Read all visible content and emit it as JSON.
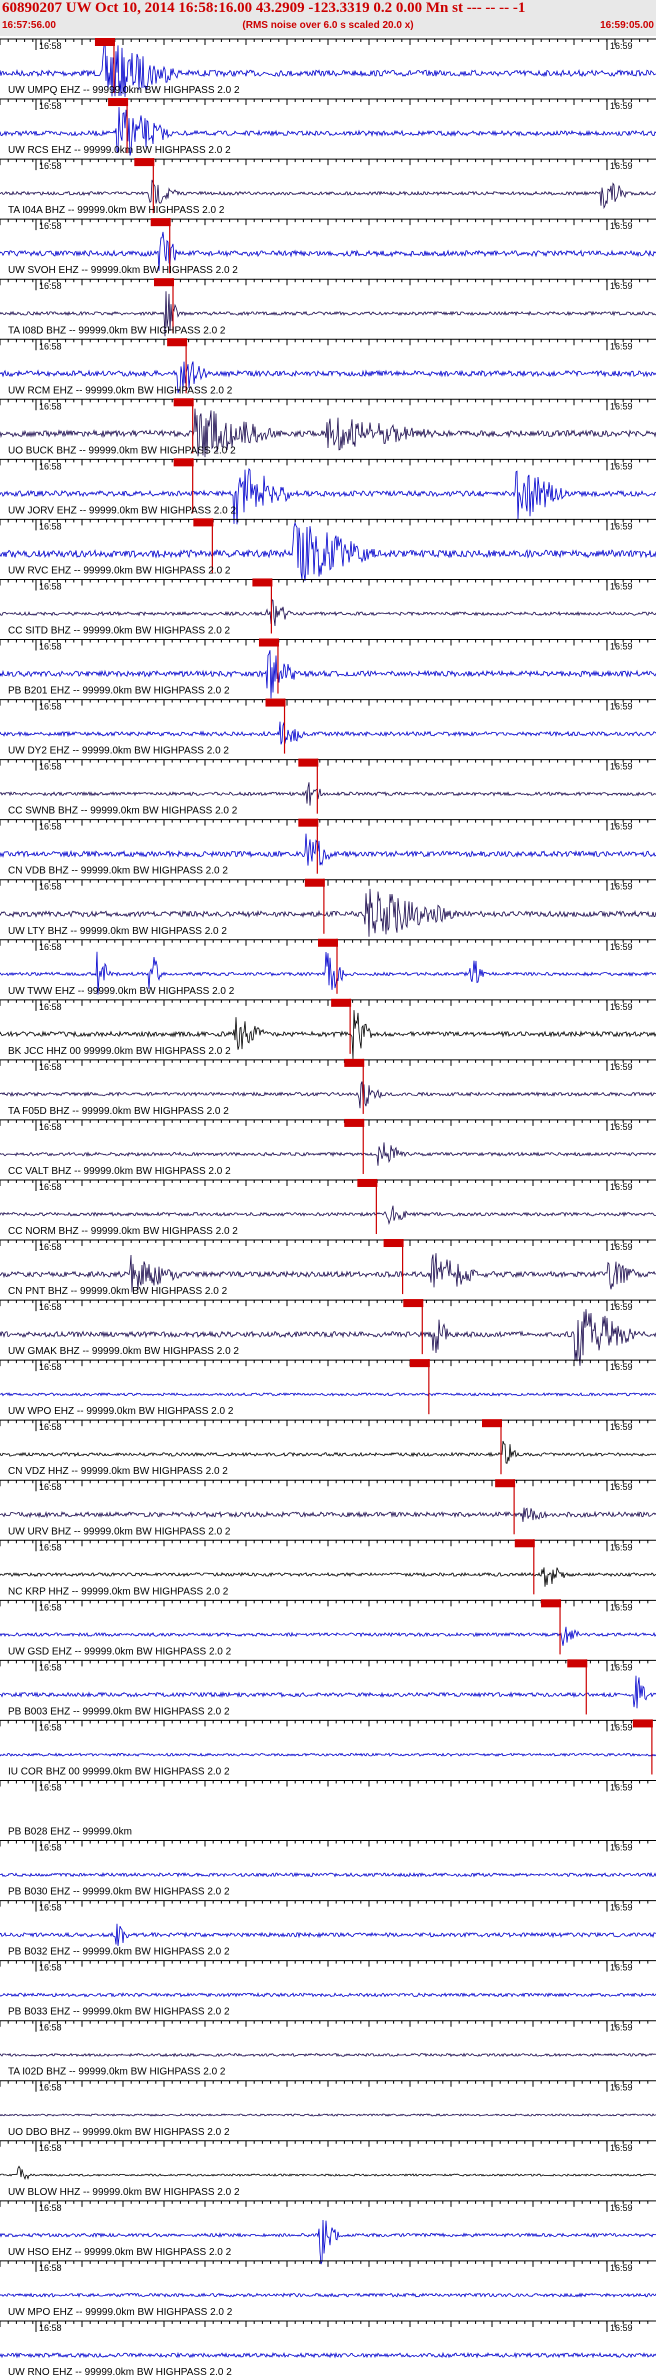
{
  "header": {
    "title": "60890207 UW Oct 10, 2014 16:58:16.00   43.2909 -123.3319  0.2 0.00 Mn st --- -- --  -1",
    "time_start": "16:57:56.00",
    "time_end": "16:59:05.00",
    "rms_note": "(RMS noise over 6.0 s scaled 20.0 x)"
  },
  "minute_labels": {
    "left": "16:58",
    "right": "16:59"
  },
  "colors": {
    "blue": "#0000cc",
    "navy": "#1a0a4d",
    "black": "#000000",
    "pick": "#cc0000"
  },
  "chart_data": {
    "type": "seismogram",
    "title": "60890207 UW Oct 10, 2014 16:58:16.00   43.2909 -123.3319  0.2 0.00 Mn st --- -- --  -1",
    "x_range": [
      "16:57:56.00",
      "16:59:05.00"
    ],
    "traces": [
      {
        "label": "UW UMPQ EHZ -- 99999.0km BW  HIGHPASS  2.0  2",
        "color": "blue",
        "amp": 0.18,
        "pick": 0.16,
        "bursts": [
          [
            0.16,
            0.13,
            1.0
          ]
        ]
      },
      {
        "label": "UW RCS EHZ -- 99999.0km BW  HIGHPASS  2.0  2",
        "color": "blue",
        "amp": 0.14,
        "pick": 0.18,
        "bursts": [
          [
            0.18,
            0.09,
            0.9
          ]
        ]
      },
      {
        "label": "TA I04A BHZ -- 99999.0km BW  HIGHPASS  2.0  2",
        "color": "navy",
        "amp": 0.1,
        "pick": 0.22,
        "bursts": [
          [
            0.23,
            0.05,
            0.45
          ],
          [
            0.92,
            0.05,
            0.5
          ]
        ]
      },
      {
        "label": "UW SVOH EHZ -- 99999.0km BW  HIGHPASS  2.0  2",
        "color": "blue",
        "amp": 0.16,
        "pick": 0.245,
        "bursts": [
          [
            0.245,
            0.03,
            0.8
          ]
        ]
      },
      {
        "label": "TA I08D BHZ -- 99999.0km BW  HIGHPASS  2.0  2",
        "color": "navy",
        "amp": 0.1,
        "pick": 0.25,
        "bursts": [
          [
            0.255,
            0.02,
            0.7
          ]
        ]
      },
      {
        "label": "UW RCM EHZ -- 99999.0km BW  HIGHPASS  2.0  2",
        "color": "blue",
        "amp": 0.16,
        "pick": 0.27,
        "bursts": [
          [
            0.275,
            0.05,
            0.6
          ]
        ]
      },
      {
        "label": "UO BUCK BHZ -- 99999.0km BW  HIGHPASS  2.0  2",
        "color": "navy",
        "amp": 0.18,
        "pick": 0.28,
        "bursts": [
          [
            0.3,
            0.14,
            0.85
          ],
          [
            0.5,
            0.2,
            0.55
          ]
        ]
      },
      {
        "label": "UW JORV EHZ -- 99999.0km BW  HIGHPASS  2.0  2",
        "color": "blue",
        "amp": 0.16,
        "pick": 0.28,
        "bursts": [
          [
            0.36,
            0.1,
            0.95
          ],
          [
            0.79,
            0.08,
            0.95
          ]
        ]
      },
      {
        "label": "UW RVC EHZ -- 99999.0km BW  HIGHPASS  2.0  2",
        "color": "blue",
        "amp": 0.22,
        "pick": 0.31,
        "bursts": [
          [
            0.45,
            0.14,
            1.0
          ]
        ]
      },
      {
        "label": "CC SITD BHZ -- 99999.0km BW  HIGHPASS  2.0  2",
        "color": "navy",
        "amp": 0.1,
        "pick": 0.4,
        "bursts": [
          [
            0.41,
            0.04,
            0.5
          ]
        ]
      },
      {
        "label": "PB B201 EHZ -- 99999.0km BW  HIGHPASS  2.0  2",
        "color": "blue",
        "amp": 0.16,
        "pick": 0.41,
        "bursts": [
          [
            0.41,
            0.05,
            0.8
          ]
        ]
      },
      {
        "label": "UW DY2 EHZ -- 99999.0km BW  HIGHPASS  2.0  2",
        "color": "blue",
        "amp": 0.12,
        "pick": 0.42,
        "bursts": [
          [
            0.43,
            0.04,
            0.5
          ]
        ]
      },
      {
        "label": "CC SWNB BHZ -- 99999.0km BW  HIGHPASS  2.0  2",
        "color": "navy",
        "amp": 0.1,
        "pick": 0.47,
        "bursts": [
          [
            0.47,
            0.03,
            0.4
          ]
        ]
      },
      {
        "label": "CN VDB BHZ -- 99999.0km BW  HIGHPASS  2.0  2",
        "color": "blue",
        "amp": 0.16,
        "pick": 0.47,
        "bursts": [
          [
            0.47,
            0.04,
            0.75
          ]
        ]
      },
      {
        "label": "UW LTY BHZ -- 99999.0km BW  HIGHPASS  2.0  2",
        "color": "navy",
        "amp": 0.16,
        "pick": 0.48,
        "bursts": [
          [
            0.56,
            0.16,
            0.8
          ]
        ]
      },
      {
        "label": "UW TWW EHZ -- 99999.0km BW  HIGHPASS  2.0  2",
        "color": "blue",
        "amp": 0.1,
        "pick": 0.5,
        "bursts": [
          [
            0.15,
            0.02,
            0.7
          ],
          [
            0.23,
            0.02,
            0.7
          ],
          [
            0.5,
            0.03,
            0.7
          ],
          [
            0.72,
            0.02,
            0.6
          ]
        ]
      },
      {
        "label": "BK JCC HHZ 00 99999.0km BW  HIGHPASS  2.0  2",
        "color": "black",
        "amp": 0.14,
        "pick": 0.52,
        "bursts": [
          [
            0.36,
            0.05,
            0.7
          ],
          [
            0.54,
            0.03,
            0.8
          ]
        ]
      },
      {
        "label": "TA F05D BHZ -- 99999.0km BW  HIGHPASS  2.0  2",
        "color": "navy",
        "amp": 0.1,
        "pick": 0.54,
        "bursts": [
          [
            0.55,
            0.04,
            0.5
          ]
        ]
      },
      {
        "label": "CC VALT BHZ -- 99999.0km BW  HIGHPASS  2.0  2",
        "color": "navy",
        "amp": 0.1,
        "pick": 0.54,
        "bursts": [
          [
            0.58,
            0.05,
            0.4
          ]
        ]
      },
      {
        "label": "CC NORM BHZ -- 99999.0km BW  HIGHPASS  2.0  2",
        "color": "navy",
        "amp": 0.1,
        "pick": 0.56,
        "bursts": [
          [
            0.59,
            0.04,
            0.35
          ]
        ]
      },
      {
        "label": "CN PNT BHZ -- 99999.0km BW  HIGHPASS  2.0  2",
        "color": "navy",
        "amp": 0.16,
        "pick": 0.6,
        "bursts": [
          [
            0.2,
            0.09,
            0.6
          ],
          [
            0.66,
            0.08,
            0.7
          ],
          [
            0.93,
            0.05,
            0.5
          ]
        ]
      },
      {
        "label": "UW GMAK BHZ -- 99999.0km BW  HIGHPASS  2.0  2",
        "color": "navy",
        "amp": 0.16,
        "pick": 0.63,
        "bursts": [
          [
            0.66,
            0.03,
            0.7
          ],
          [
            0.88,
            0.1,
            1.0
          ]
        ]
      },
      {
        "label": "UW WPO EHZ -- 99999.0km BW  HIGHPASS  2.0  2",
        "color": "blue",
        "amp": 0.08,
        "pick": 0.64,
        "bursts": []
      },
      {
        "label": "CN VDZ HHZ -- 99999.0km BW  HIGHPASS  2.0  2",
        "color": "black",
        "amp": 0.1,
        "pick": 0.75,
        "bursts": [
          [
            0.77,
            0.02,
            0.5
          ]
        ]
      },
      {
        "label": "UW URV BHZ -- 99999.0km BW  HIGHPASS  2.0  2",
        "color": "navy",
        "amp": 0.14,
        "pick": 0.77,
        "bursts": [
          [
            0.8,
            0.04,
            0.4
          ]
        ]
      },
      {
        "label": "NC KRP HHZ -- 99999.0km BW  HIGHPASS  2.0  2",
        "color": "black",
        "amp": 0.1,
        "pick": 0.8,
        "bursts": [
          [
            0.83,
            0.04,
            0.45
          ]
        ]
      },
      {
        "label": "UW GSD EHZ -- 99999.0km BW  HIGHPASS  2.0  2",
        "color": "blue",
        "amp": 0.1,
        "pick": 0.84,
        "bursts": [
          [
            0.86,
            0.03,
            0.35
          ]
        ]
      },
      {
        "label": "PB B003 EHZ -- 99999.0km BW  HIGHPASS  2.0  2",
        "color": "blue",
        "amp": 0.12,
        "pick": 0.88,
        "bursts": [
          [
            0.97,
            0.02,
            0.8
          ]
        ]
      },
      {
        "label": "IU COR BHZ 00 99999.0km BW  HIGHPASS  2.0  2",
        "color": "blue",
        "amp": 0.08,
        "pick": 0.98,
        "bursts": []
      },
      {
        "label": "PB B028 EHZ -- 99999.0km",
        "color": "blue",
        "amp": 0.0,
        "pick": null,
        "bursts": []
      },
      {
        "label": "PB B030 EHZ -- 99999.0km BW  HIGHPASS  2.0  2",
        "color": "blue",
        "amp": 0.1,
        "pick": null,
        "bursts": []
      },
      {
        "label": "PB B032 EHZ -- 99999.0km BW  HIGHPASS  2.0  2",
        "color": "blue",
        "amp": 0.12,
        "pick": null,
        "bursts": [
          [
            0.18,
            0.02,
            0.4
          ]
        ]
      },
      {
        "label": "PB B033 EHZ -- 99999.0km BW  HIGHPASS  2.0  2",
        "color": "blue",
        "amp": 0.1,
        "pick": null,
        "bursts": []
      },
      {
        "label": "TA I02D BHZ -- 99999.0km BW  HIGHPASS  2.0  2",
        "color": "navy",
        "amp": 0.08,
        "pick": null,
        "bursts": []
      },
      {
        "label": "UO DBO BHZ -- 99999.0km BW  HIGHPASS  2.0  2",
        "color": "navy",
        "amp": 0.06,
        "pick": null,
        "bursts": []
      },
      {
        "label": "UW BLOW HHZ -- 99999.0km BW  HIGHPASS  2.0  2",
        "color": "black",
        "amp": 0.06,
        "pick": null,
        "bursts": [
          [
            0.03,
            0.02,
            0.3
          ]
        ]
      },
      {
        "label": "UW HSO EHZ -- 99999.0km BW  HIGHPASS  2.0  2",
        "color": "blue",
        "amp": 0.1,
        "pick": null,
        "bursts": [
          [
            0.49,
            0.03,
            0.9
          ]
        ]
      },
      {
        "label": "UW MPO EHZ -- 99999.0km BW  HIGHPASS  2.0  2",
        "color": "blue",
        "amp": 0.1,
        "pick": null,
        "bursts": []
      },
      {
        "label": "UW RNO EHZ -- 99999.0km BW  HIGHPASS  2.0  2",
        "color": "blue",
        "amp": 0.12,
        "pick": null,
        "bursts": []
      }
    ]
  }
}
